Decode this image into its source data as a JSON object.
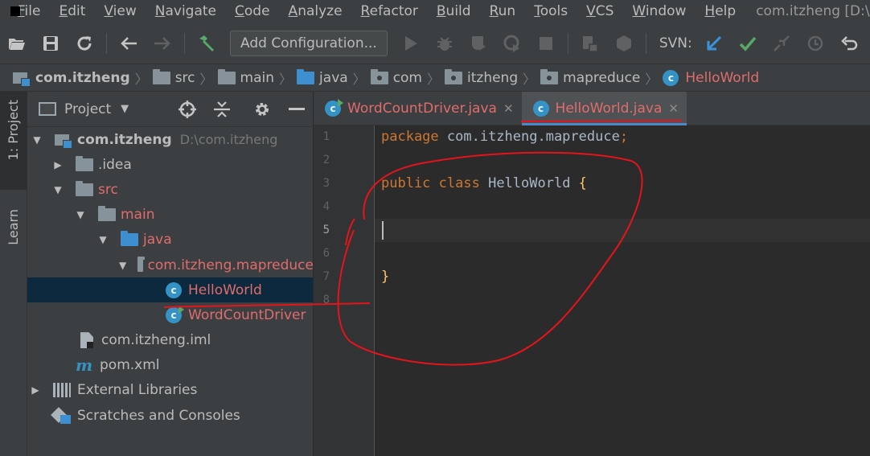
{
  "menubar": {
    "items": [
      "File",
      "Edit",
      "View",
      "Navigate",
      "Code",
      "Analyze",
      "Refactor",
      "Build",
      "Run",
      "Tools",
      "VCS",
      "Window",
      "Help"
    ],
    "window_title": "com.itzheng [D:\\com"
  },
  "toolbar": {
    "add_configuration": "Add Configuration...",
    "svn_label": "SVN:",
    "colors": {
      "svn_update": "#3b93dc",
      "svn_commit": "#59a869"
    }
  },
  "breadcrumb": {
    "items": [
      "com.itzheng",
      "src",
      "main",
      "java",
      "com",
      "itzheng",
      "mapreduce",
      "HelloWorld"
    ]
  },
  "side_strip": {
    "project_tab": "1: Project",
    "learn_tab": "Learn"
  },
  "project_panel": {
    "title": "Project",
    "tree": [
      {
        "label": "com.itzheng",
        "hint": "D:\\com.itzheng"
      },
      {
        "label": ".idea"
      },
      {
        "label": "src"
      },
      {
        "label": "main"
      },
      {
        "label": "java"
      },
      {
        "label": "com.itzheng.mapreduce"
      },
      {
        "label": "HelloWorld"
      },
      {
        "label": "WordCountDriver"
      },
      {
        "label": "com.itzheng.iml"
      },
      {
        "label": "pom.xml"
      },
      {
        "label": "External Libraries"
      },
      {
        "label": "Scratches and Consoles"
      }
    ]
  },
  "editor": {
    "tabs": [
      {
        "label": "WordCountDriver.java",
        "active": false
      },
      {
        "label": "HelloWorld.java",
        "active": true
      }
    ],
    "line_numbers": [
      "1",
      "2",
      "3",
      "4",
      "5",
      "6",
      "7",
      "8"
    ],
    "code": {
      "kw_package": "package",
      "package_name": " com.itzheng.mapreduce",
      "semicolon": ";",
      "kw_public": "public",
      "kw_class": " class",
      "class_name": " HelloWorld ",
      "open_brace": "{",
      "close_brace": "}"
    },
    "current_line": 5
  },
  "annotation_color": "#e5141b"
}
